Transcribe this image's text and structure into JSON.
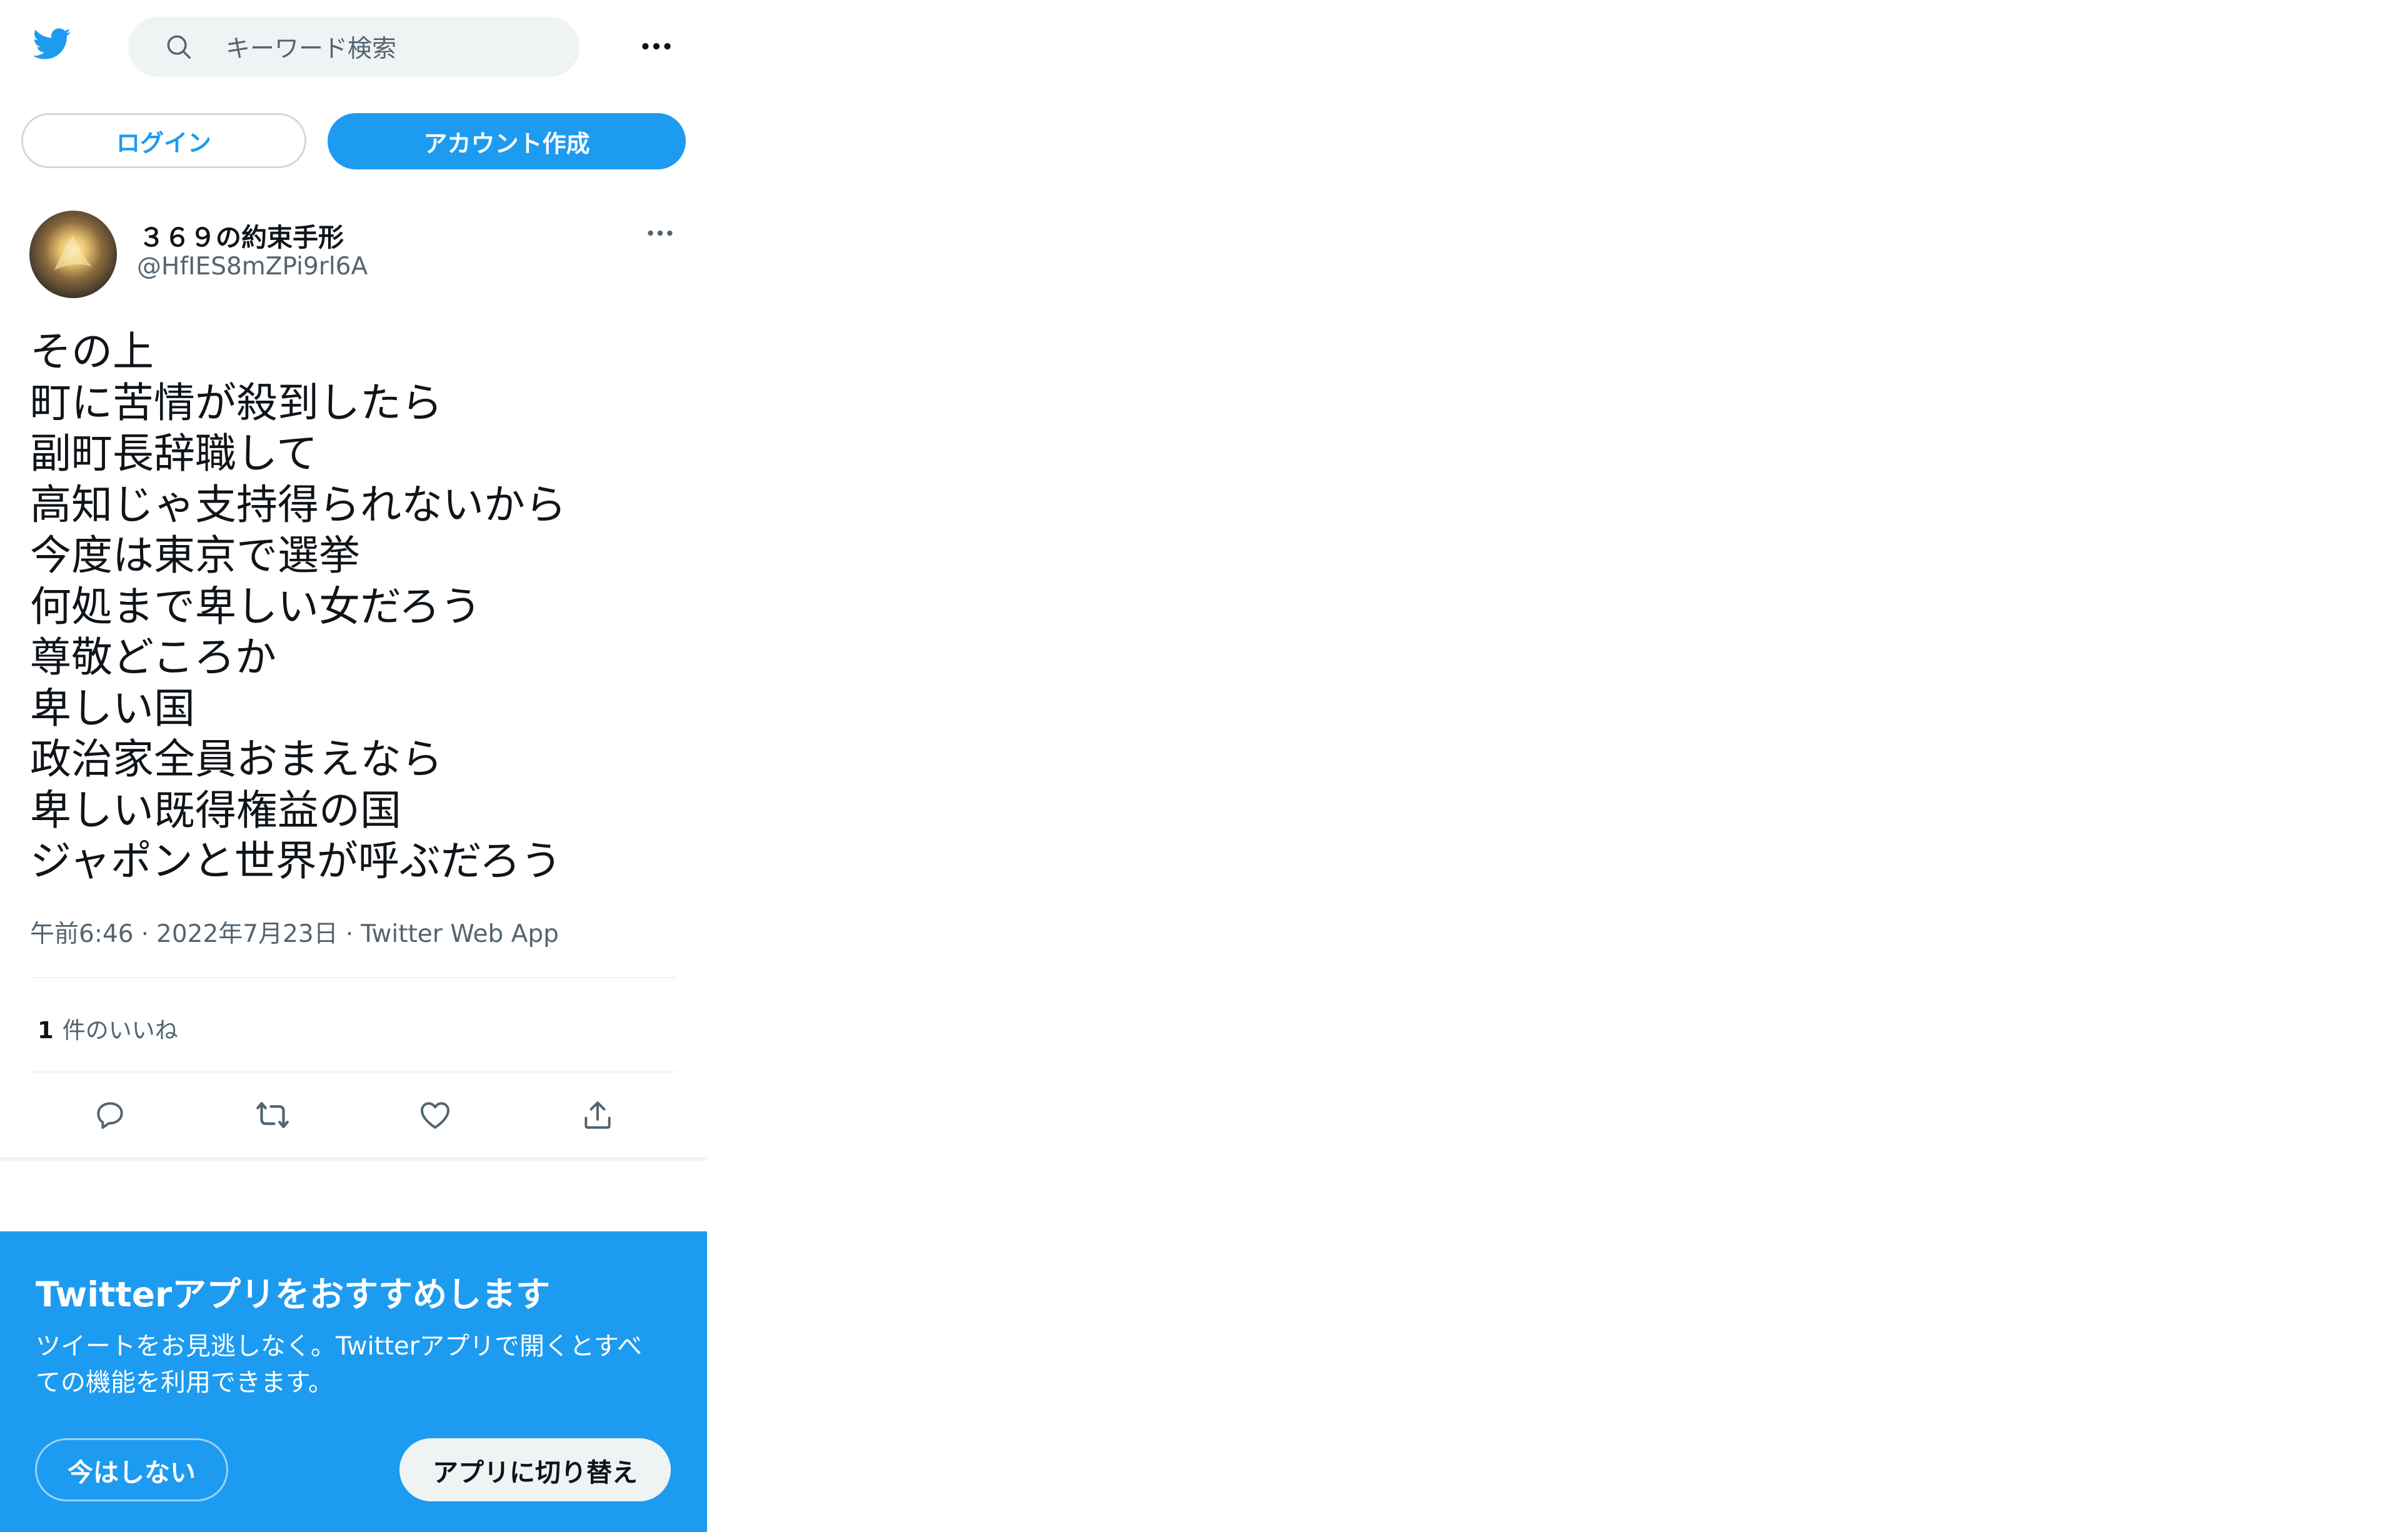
{
  "header": {
    "search_placeholder": "キーワード検索"
  },
  "auth": {
    "login_label": "ログイン",
    "signup_label": "アカウント作成"
  },
  "tweet": {
    "display_name": "３６９の約束手形",
    "handle": "@HfIES8mZPi9rl6A",
    "lines": [
      "その上",
      "町に苦情が殺到したら",
      "副町長辞職して",
      "高知じゃ支持得られないから",
      "今度は東京で選挙",
      "何処まで卑しい女だろう",
      "尊敬どころか",
      "卑しい国",
      "政治家全員おまえなら",
      "卑しい既得権益の国",
      "ジャポンと世界が呼ぶだろう"
    ],
    "time": "午前6:46",
    "date": "2022年7月23日",
    "source": "Twitter Web App",
    "separator": "·",
    "likes_count": "1",
    "likes_label": "件のいいね"
  },
  "actions": {
    "icons": [
      "reply-icon",
      "retweet-icon",
      "like-icon",
      "share-icon"
    ]
  },
  "promo": {
    "title": "Twitterアプリをおすすめします",
    "desc_line1": "ツイートをお見逃しなく。Twitterアプリで開くとすべ",
    "desc_line2": "ての機能を利用できます。",
    "not_now_label": "今はしない",
    "switch_label": "アプリに切り替え"
  },
  "colors": {
    "accent": "#1d9bf0",
    "text_primary": "#0f1419",
    "text_secondary": "#536471",
    "search_bg": "#eff3f4",
    "border": "#cfd9de"
  }
}
